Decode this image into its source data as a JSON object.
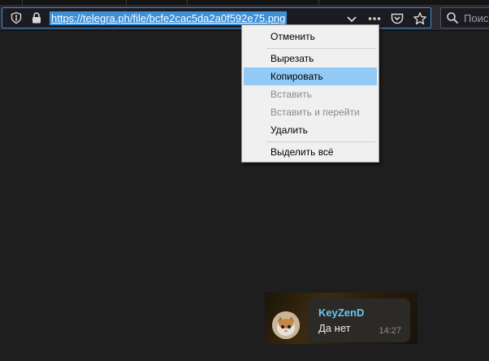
{
  "browser": {
    "url": "https://telegra.ph/file/bcfe2cac5da2a0f592e75.png",
    "search_placeholder": "Поис"
  },
  "context_menu": {
    "items": [
      {
        "label": "Отменить",
        "state": "enabled"
      },
      {
        "label": "Вырезать",
        "state": "enabled"
      },
      {
        "label": "Копировать",
        "state": "highlighted"
      },
      {
        "label": "Вставить",
        "state": "disabled"
      },
      {
        "label": "Вставить и перейти",
        "state": "disabled"
      },
      {
        "label": "Удалить",
        "state": "enabled"
      },
      {
        "label": "Выделить всё",
        "state": "enabled"
      }
    ]
  },
  "chat": {
    "sender": "KeyZenD",
    "text": "Да нет",
    "time": "14:27"
  },
  "colors": {
    "accent": "#3d8fd6",
    "menu_highlight": "#91c9f7",
    "sender_name": "#6cc3f1",
    "page_background": "#1e1e1e"
  }
}
